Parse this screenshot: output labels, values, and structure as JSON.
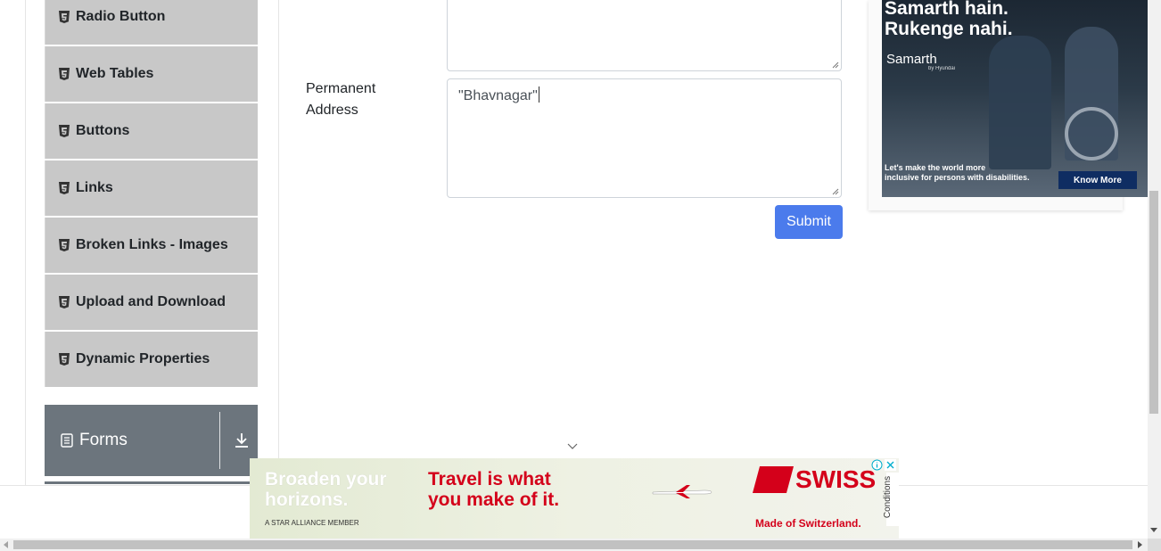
{
  "sidebar": {
    "items": [
      {
        "label": "Radio Button",
        "icon": "html5-icon"
      },
      {
        "label": "Web Tables",
        "icon": "html5-icon"
      },
      {
        "label": "Buttons",
        "icon": "html5-icon"
      },
      {
        "label": "Links",
        "icon": "html5-icon"
      },
      {
        "label": "Broken Links - Images",
        "icon": "html5-icon"
      },
      {
        "label": "Upload and Download",
        "icon": "html5-icon"
      },
      {
        "label": "Dynamic Properties",
        "icon": "html5-icon"
      }
    ],
    "group": {
      "label": "Forms",
      "icon": "form-icon",
      "toggle_icon": "download-arrow-icon"
    }
  },
  "form": {
    "permanent_address_label": "Permanent Address",
    "permanent_address_value": "\"Bhavnagar\"",
    "submit_label": "Submit"
  },
  "ad_right": {
    "headline_line1": "Samarth hain.",
    "headline_line2": "Rukenge nahi.",
    "brand": "Samarth",
    "brand_sub": "by Hyundai",
    "tagline_line1": "Let's make the world more",
    "tagline_line2": "inclusive for persons with disabilities.",
    "cta": "Know More"
  },
  "ad_bottom": {
    "headline_white_1": "Broaden your",
    "headline_white_2": "horizons.",
    "headline_red_1": "Travel is what",
    "headline_red_2": "you make of it.",
    "alliance": "A STAR ALLIANCE MEMBER",
    "brand": "SWISS",
    "made": "Made of Switzerland.",
    "conditions": "Conditions"
  },
  "colors": {
    "sidebar_item_bg": "#c8c8c8",
    "forms_group_bg": "#6c757d",
    "submit_bg": "#4b7bec",
    "swiss_red": "#d4001a"
  }
}
